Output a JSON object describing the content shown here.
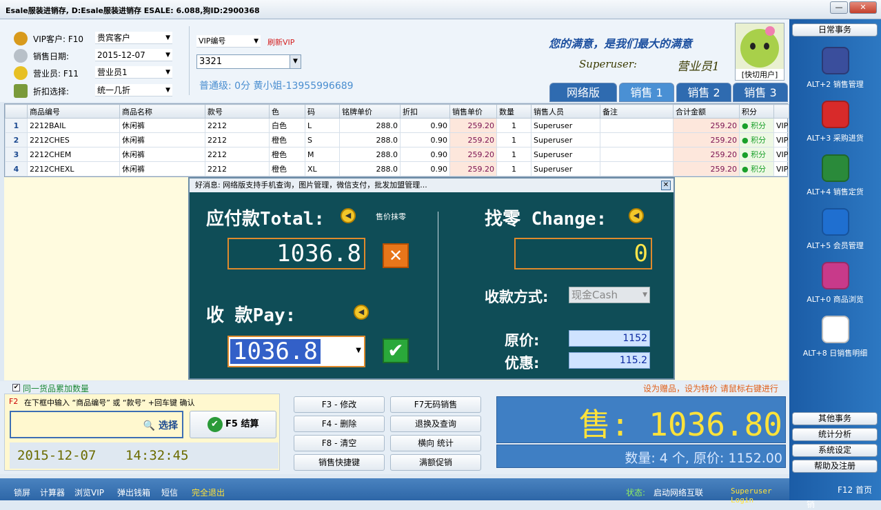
{
  "window": {
    "title": "Esale服装进销存, D:Esale服装进销存  ESALE: 6.088,狗ID:2900368",
    "minimize": "—",
    "close": "✕"
  },
  "top": {
    "vip_label": "VIP客户: F10",
    "vip_value": "贵宾客户",
    "date_label": "销售日期:",
    "date_value": "2015-12-07",
    "clerk_label": "营业员:  F11",
    "clerk_value": "营业员1",
    "discount_label": "折扣选择:",
    "discount_value": "统一几折",
    "vipno_select": "VIP编号",
    "refresh_vip": "刷新VIP",
    "vipno_value": "3321",
    "member_info": "普通级: 0分  黄小姐-13955996689",
    "slogan": "您的满意，是我们最大的满意",
    "user": "Superuser:",
    "role": "营业员1",
    "avatar_caption": "[快切用户]"
  },
  "tabs": [
    {
      "label": "网络版",
      "color": "#2f6bb0"
    },
    {
      "label": "销售 1",
      "color": "#3d86cc"
    },
    {
      "label": "销售 2",
      "color": "#2f6bb0"
    },
    {
      "label": "销售 3",
      "color": "#2f6bb0"
    }
  ],
  "table": {
    "headers": [
      "",
      "商品编号",
      "商品名称",
      "款号",
      "色",
      "码",
      "铭牌单价",
      "折扣",
      "销售单价",
      "数量",
      "销售人员",
      "备注",
      "合计金额",
      "积分",
      ""
    ],
    "rows": [
      [
        "1",
        "2212BAIL",
        "休闲裤",
        "2212",
        "白色",
        "L",
        "288.0",
        "0.90",
        "259.20",
        "1",
        "Superuser",
        "",
        "259.20",
        "积分",
        "VIP"
      ],
      [
        "2",
        "2212CHES",
        "休闲裤",
        "2212",
        "橙色",
        "S",
        "288.0",
        "0.90",
        "259.20",
        "1",
        "Superuser",
        "",
        "259.20",
        "积分",
        "VIP"
      ],
      [
        "3",
        "2212CHEM",
        "休闲裤",
        "2212",
        "橙色",
        "M",
        "288.0",
        "0.90",
        "259.20",
        "1",
        "Superuser",
        "",
        "259.20",
        "积分",
        "VIP"
      ],
      [
        "4",
        "2212CHEXL",
        "休闲裤",
        "2212",
        "橙色",
        "XL",
        "288.0",
        "0.90",
        "259.20",
        "1",
        "Superuser",
        "",
        "259.20",
        "积分",
        "VIP"
      ]
    ]
  },
  "dialog": {
    "title": "好消息: 网络版支持手机查询，图片管理，微信支付，批发加盟管理...",
    "total_label": "应付款Total:",
    "round_label": "售价抹零",
    "total_value": "1036.8",
    "change_label": "找零 Change:",
    "change_value": "0",
    "pay_label": "收  款Pay:",
    "pay_value": "1036.8",
    "method_label": "收款方式:",
    "method_value": "现金Cash",
    "orig_label": "原价:",
    "orig_value": "1152",
    "disc_label": "优惠:",
    "disc_value": "115.2"
  },
  "bottom": {
    "accumulate": "同一货品累加数量",
    "gift_tip": "设为赠品，设为特价 请鼠标右键进行",
    "hint_key": "F2",
    "hint": "在下框中输入 “商品编号” 或 “款号” +回车键 确认",
    "select_btn": "选择",
    "settle_btn": "F5 结算",
    "date": "2015-12-07",
    "time": "14:32:45",
    "fkeys": [
      "F3 - 修改",
      "F7无码销售",
      "F4 - 删除",
      "退换及查询",
      "F8 - 清空",
      "横向 统计",
      "销售快捷键",
      "满额促销"
    ],
    "sale_total": "售: 1036.80",
    "sale_summary": "数量: 4 个, 原价: 1152.00"
  },
  "sidebar": {
    "daily": "日常事务",
    "items": [
      {
        "label": "ALT+2 销售管理",
        "icon": "hat-icon",
        "color": "#3a4e9c"
      },
      {
        "label": "ALT+3 采购进货",
        "icon": "dice-red-icon",
        "color": "#d82a2a"
      },
      {
        "label": "ALT+4 销售定货",
        "icon": "feather-icon",
        "color": "#2a8a3a"
      },
      {
        "label": "ALT+5 会员管理",
        "icon": "accessibility-icon",
        "color": "#1f6fd0"
      },
      {
        "label": "ALT+0 商品浏览",
        "icon": "balls-icon",
        "color": "#c83a8a"
      },
      {
        "label": "ALT+8 日销售明细",
        "icon": "dice-white-icon",
        "color": "#ffffff"
      }
    ],
    "other": "其他事务",
    "stats": "统计分析",
    "system": "系统设定",
    "help": "帮助及注册"
  },
  "status": {
    "links": [
      "锁屏",
      "计算器",
      "浏览VIP",
      "弹出钱箱",
      "短信"
    ],
    "exit": "完全退出",
    "state_label": "状态:",
    "state_value": "启动网络互联",
    "login": "Superuser Login",
    "logout": "注销",
    "home": "F12 首页"
  }
}
